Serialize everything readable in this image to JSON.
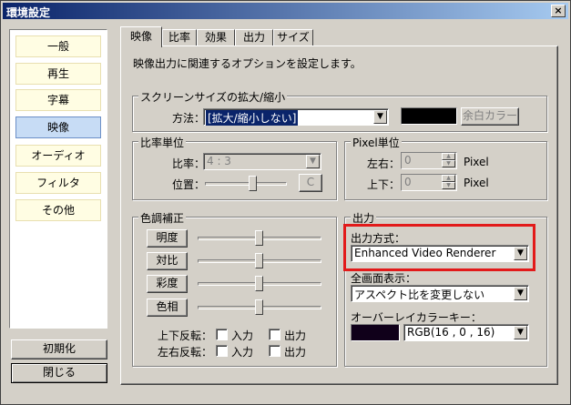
{
  "window": {
    "title": "環境設定",
    "close_glyph": "×"
  },
  "sidebar": {
    "items": [
      {
        "label": "一般"
      },
      {
        "label": "再生"
      },
      {
        "label": "字幕"
      },
      {
        "label": "映像"
      },
      {
        "label": "オーディオ"
      },
      {
        "label": "フィルタ"
      },
      {
        "label": "その他"
      }
    ],
    "selected": "映像",
    "reset_label": "初期化",
    "close_label": "閉じる"
  },
  "tabs": [
    {
      "label": "映像"
    },
    {
      "label": "比率"
    },
    {
      "label": "効果"
    },
    {
      "label": "出力"
    },
    {
      "label": "サイズ"
    }
  ],
  "description": "映像出力に関連するオプションを設定します。",
  "screen_size": {
    "group_title": "スクリーンサイズの拡大/縮小",
    "method_label": "方法：",
    "method_value": "[拡大/縮小しない]",
    "blank_color_label": "余白カラー",
    "swatch_color": "#000000"
  },
  "ratio_unit": {
    "group_title": "比率単位",
    "ratio_label": "比率：",
    "ratio_value": "4 : 3",
    "position_label": "位置：",
    "c_button": "C"
  },
  "pixel_unit": {
    "group_title": "Pixel単位",
    "lr_label": "左右：",
    "lr_value": "0",
    "ud_label": "上下：",
    "ud_value": "0",
    "unit": "Pixel"
  },
  "color_correction": {
    "group_title": "色調補正",
    "buttons": [
      {
        "label": "明度",
        "level": 0.5
      },
      {
        "label": "対比",
        "level": 0.5
      },
      {
        "label": "彩度",
        "level": 0.5
      },
      {
        "label": "色相",
        "level": 0.5
      }
    ],
    "flip_v_label": "上下反転：",
    "flip_h_label": "左右反転：",
    "input_label": "入力",
    "output_label": "出力"
  },
  "output": {
    "group_title": "出力",
    "method_label": "出力方式：",
    "method_value": "Enhanced Video Renderer",
    "fullscreen_label": "全画面表示：",
    "fullscreen_value": "アスペクト比を変更しない",
    "overlay_label": "オーバーレイカラーキー：",
    "overlay_value": "RGB(16 , 0 , 16)",
    "overlay_color": "#10001a"
  },
  "colors": {
    "highlight": "#e21a1a",
    "title_bar": "#0a246a",
    "selected_item": "#c7dcf5"
  }
}
